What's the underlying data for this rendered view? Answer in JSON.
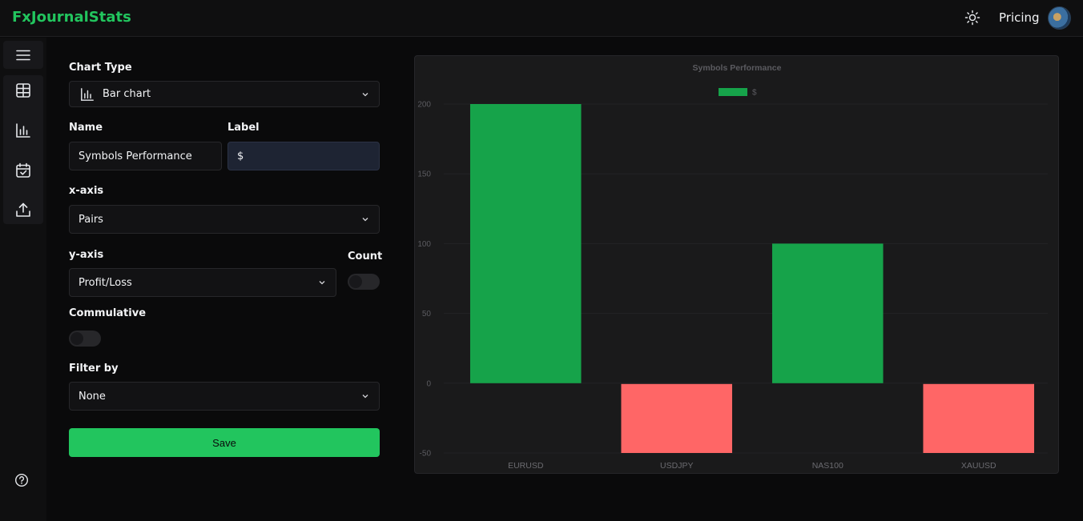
{
  "header": {
    "brand": "FxJournalStats",
    "pricing_label": "Pricing",
    "theme_icon": "sun-icon",
    "avatar_icon": "user-avatar"
  },
  "sidebar": {
    "items": [
      {
        "icon": "menu-icon"
      },
      {
        "icon": "table-icon"
      },
      {
        "icon": "bar-chart-icon"
      },
      {
        "icon": "calendar-check-icon"
      },
      {
        "icon": "upload-icon"
      }
    ],
    "help_icon": "help-circle-icon"
  },
  "form": {
    "chart_type_label": "Chart Type",
    "chart_type_value": "Bar chart",
    "name_label": "Name",
    "name_value": "Symbols Performance",
    "label_label": "Label",
    "label_value": "$",
    "xaxis_label": "x-axis",
    "xaxis_value": "Pairs",
    "yaxis_label": "y-axis",
    "yaxis_value": "Profit/Loss",
    "count_label": "Count",
    "count_on": false,
    "cumulative_label": "Commulative",
    "cumulative_on": false,
    "filter_label": "Filter by",
    "filter_value": "None",
    "save_label": "Save"
  },
  "colors": {
    "accent": "#22c55e",
    "positive_bar": "#16a34a",
    "negative_bar": "#ff6666"
  },
  "chart_data": {
    "type": "bar",
    "title": "Symbols Performance",
    "legend": "$",
    "legend_position": "top",
    "categories": [
      "EURUSD",
      "USDJPY",
      "NAS100",
      "XAUUSD"
    ],
    "values": [
      200,
      -50,
      100,
      -50
    ],
    "yticks": [
      200,
      150,
      100,
      50,
      0,
      -50
    ],
    "ylim": [
      -50,
      200
    ],
    "grid": true
  }
}
